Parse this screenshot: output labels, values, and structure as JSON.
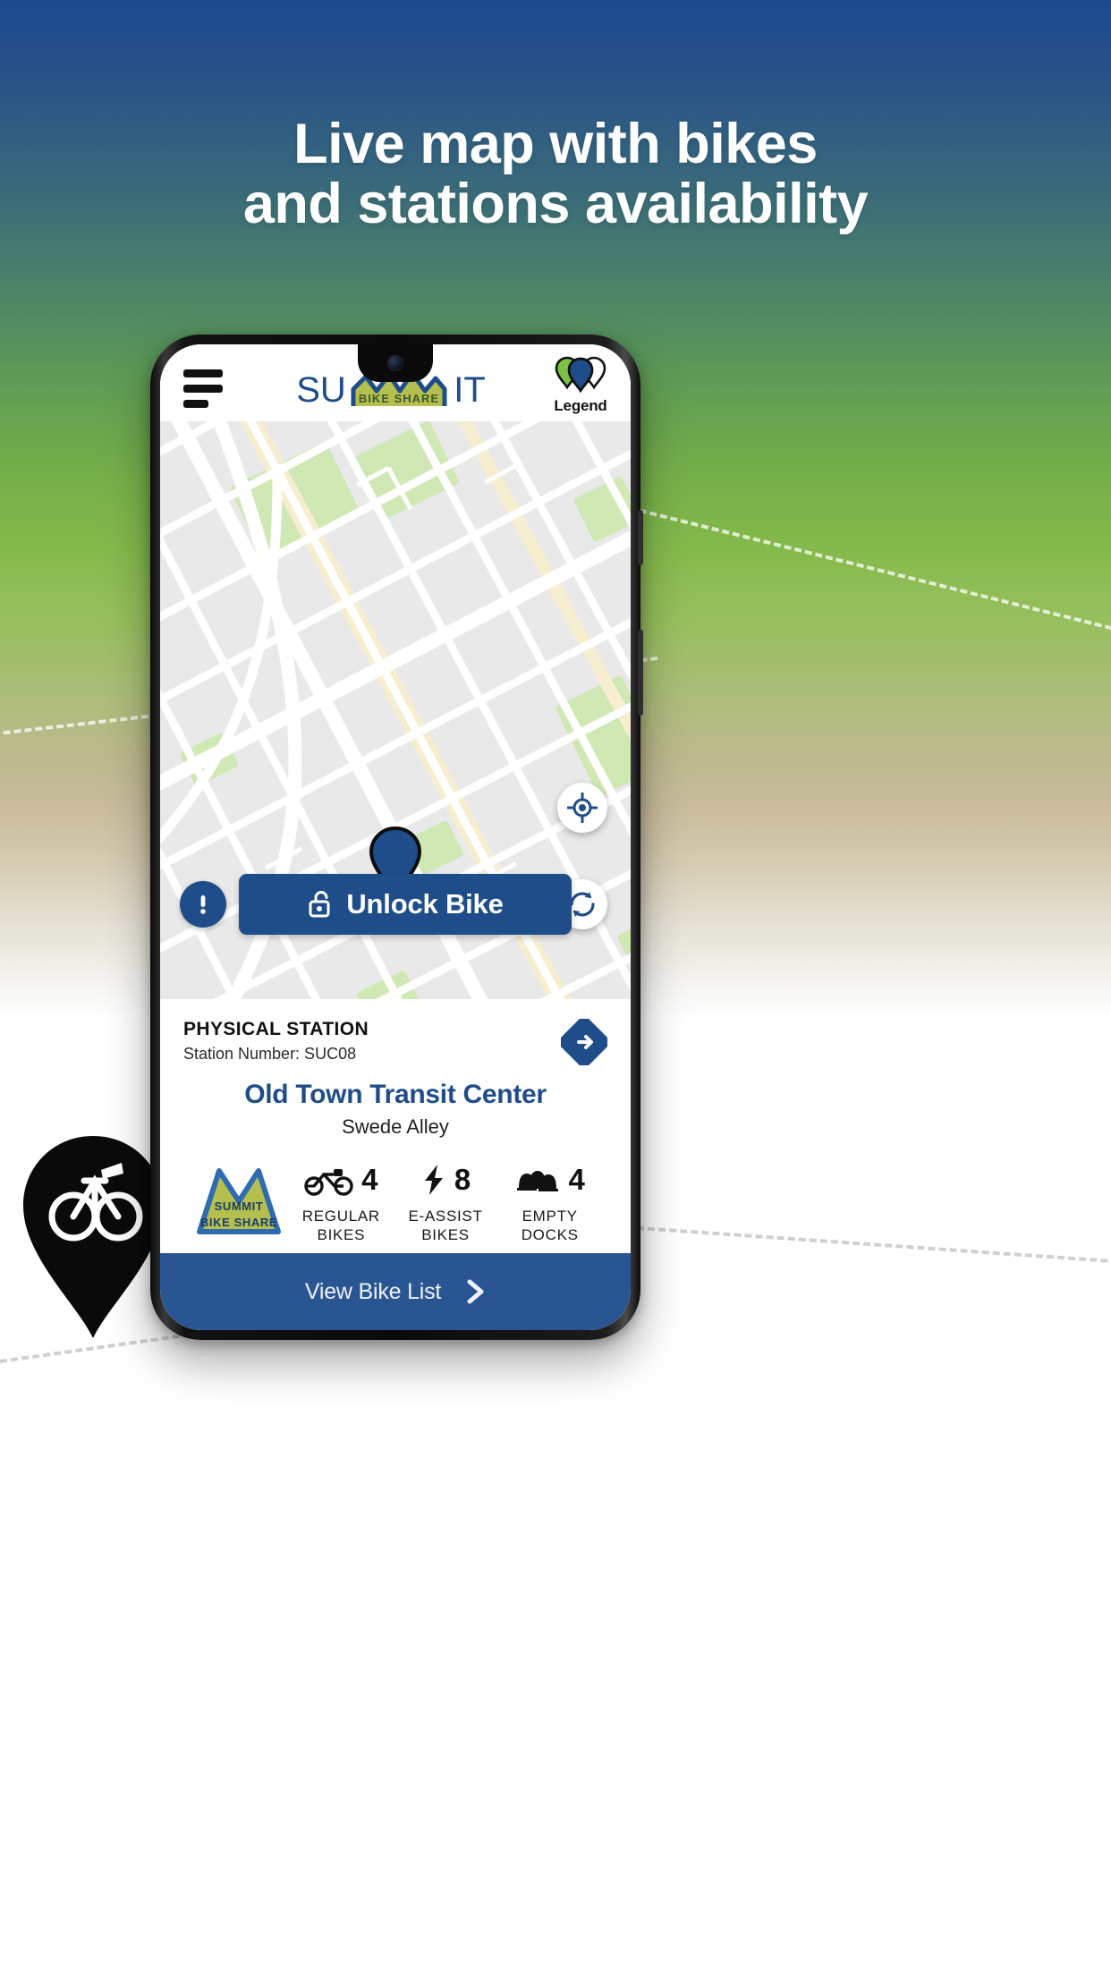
{
  "promo": {
    "headline_line1": "Live map with bikes",
    "headline_line2": "and stations availability",
    "background_colors": {
      "top": "#1d4a8f",
      "mid_green": "#7cb54a",
      "sand": "#c9bc9c",
      "bottom": "#ffffff"
    }
  },
  "app": {
    "header": {
      "menu_icon": "hamburger-menu-icon",
      "brand_primary": "SU",
      "brand_secondary": "IT",
      "brand_badge": "BIKE SHARE",
      "legend_label": "Legend",
      "legend_icon": "map-pins-icon"
    },
    "map": {
      "pin_icon": "location-pin-icon",
      "locate_icon": "crosshair-icon",
      "refresh_icon": "refresh-icon",
      "alert_icon": "exclamation-icon"
    },
    "unlock": {
      "label": "Unlock Bike",
      "icon": "open-padlock-icon",
      "color": "#1f4d89"
    },
    "station": {
      "kind": "PHYSICAL STATION",
      "number_label": "Station Number: SUC08",
      "name": "Old Town Transit Center",
      "address": "Swede Alley",
      "directions_icon": "directions-arrow-icon",
      "badge_line1": "SUMMIT",
      "badge_line2": "BIKE SHARE",
      "name_color": "#1f4d89",
      "stats": [
        {
          "icon": "bicycle-icon",
          "value": "4",
          "label_line1": "REGULAR",
          "label_line2": "BIKES"
        },
        {
          "icon": "bolt-icon",
          "value": "8",
          "label_line1": "E-ASSIST",
          "label_line2": "BIKES"
        },
        {
          "icon": "docks-icon",
          "value": "4",
          "label_line1": "EMPTY",
          "label_line2": "DOCKS"
        }
      ]
    },
    "bottom_bar": {
      "label": "View Bike List",
      "chevron_icon": "chevron-right-icon",
      "color": "#2a5593"
    }
  },
  "decor": {
    "big_pin_icon": "bike-pin-icon"
  }
}
